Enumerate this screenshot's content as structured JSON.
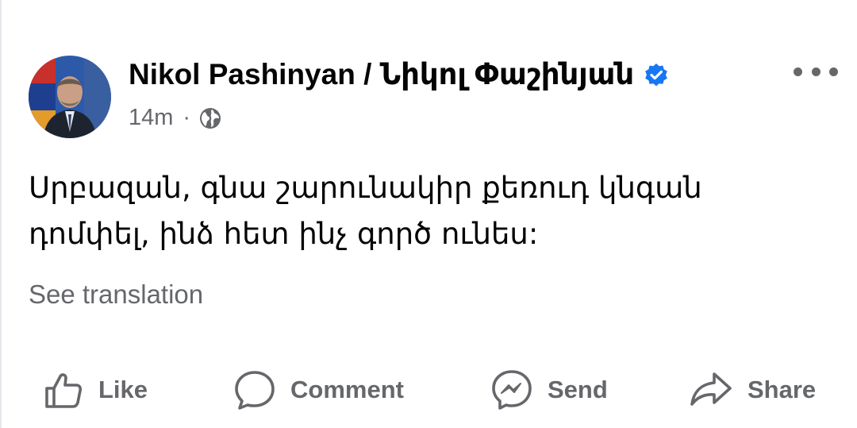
{
  "post": {
    "author": "Nikol Pashinyan / Նիկոլ Փաշինյան",
    "time": "14m",
    "separator": "·",
    "text": "Սրբազան, գնա շարունակիր քեռուդ կնգան դոմփել, ինձ հետ ինչ գործ ունես:",
    "see_translation": "See translation"
  },
  "actions": {
    "like": "Like",
    "comment": "Comment",
    "send": "Send",
    "share": "Share"
  },
  "colors": {
    "verified": "#1877f2",
    "secondary_text": "#65676b"
  },
  "icons": [
    "verified-badge-icon",
    "globe-icon",
    "more-options-icon",
    "thumbs-up-icon",
    "comment-bubble-icon",
    "messenger-icon",
    "share-arrow-icon"
  ]
}
